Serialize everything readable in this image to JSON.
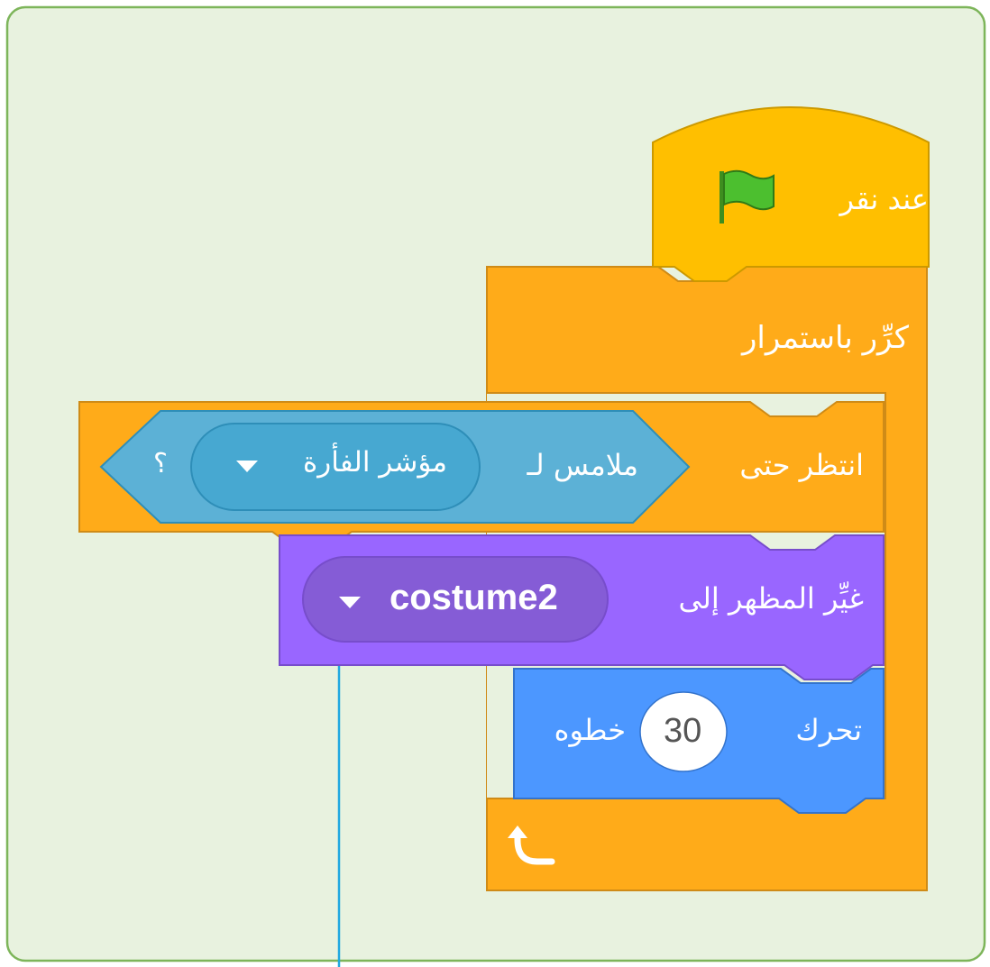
{
  "blocks": {
    "when_flag": {
      "label": "عند نقر",
      "icon": "green-flag-icon",
      "color": "#FFBF00"
    },
    "forever": {
      "label": "كرِّر باستمرار",
      "loop_icon": "loop-arrow-icon",
      "color": "#FFAB19"
    },
    "wait_until": {
      "label": "انتظر حتى",
      "color": "#FFAB19"
    },
    "touching": {
      "label": "ملامس لـ",
      "target": "مؤشر الفأرة",
      "question_mark": "؟",
      "dropdown_icon": "dropdown-arrow-icon",
      "color": "#5CB1D6"
    },
    "switch_costume": {
      "label": "غيِّر المظهر إلى",
      "value": "costume2",
      "dropdown_icon": "dropdown-arrow-icon",
      "color": "#9966FF"
    },
    "move_steps": {
      "label": "تحرك",
      "value": "30",
      "suffix": "خطوه",
      "color": "#4C97FF"
    }
  },
  "workspace": {
    "background": "#E8F2DF",
    "border": "#7DB55A"
  }
}
